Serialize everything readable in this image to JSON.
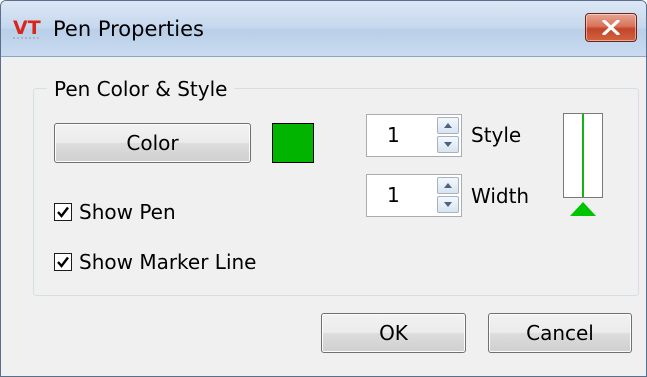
{
  "window": {
    "title": "Pen Properties",
    "app_logo_text": "VT",
    "close_icon": "close-icon"
  },
  "group": {
    "legend": "Pen Color & Style"
  },
  "color_button": {
    "label": "Color"
  },
  "pen_color": "#00b400",
  "checkboxes": {
    "show_pen": {
      "label": "Show Pen",
      "checked": true
    },
    "show_marker_line": {
      "label": "Show Marker Line",
      "checked": true
    }
  },
  "style_spinner": {
    "value": "1",
    "label": "Style"
  },
  "width_spinner": {
    "value": "1",
    "label": "Width"
  },
  "buttons": {
    "ok": "OK",
    "cancel": "Cancel"
  },
  "colors": {
    "preview_line": "#14b414",
    "marker": "#00c400",
    "logo_red": "#d9261c"
  }
}
